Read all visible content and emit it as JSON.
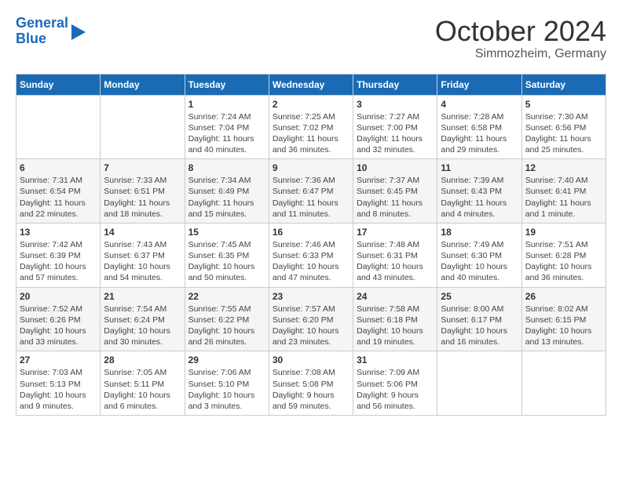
{
  "logo": {
    "line1": "General",
    "line2": "Blue"
  },
  "title": "October 2024",
  "subtitle": "Simmozheim, Germany",
  "days_of_week": [
    "Sunday",
    "Monday",
    "Tuesday",
    "Wednesday",
    "Thursday",
    "Friday",
    "Saturday"
  ],
  "weeks": [
    [
      {
        "day": "",
        "info": ""
      },
      {
        "day": "",
        "info": ""
      },
      {
        "day": "1",
        "info": "Sunrise: 7:24 AM\nSunset: 7:04 PM\nDaylight: 11 hours and 40 minutes."
      },
      {
        "day": "2",
        "info": "Sunrise: 7:25 AM\nSunset: 7:02 PM\nDaylight: 11 hours and 36 minutes."
      },
      {
        "day": "3",
        "info": "Sunrise: 7:27 AM\nSunset: 7:00 PM\nDaylight: 11 hours and 32 minutes."
      },
      {
        "day": "4",
        "info": "Sunrise: 7:28 AM\nSunset: 6:58 PM\nDaylight: 11 hours and 29 minutes."
      },
      {
        "day": "5",
        "info": "Sunrise: 7:30 AM\nSunset: 6:56 PM\nDaylight: 11 hours and 25 minutes."
      }
    ],
    [
      {
        "day": "6",
        "info": "Sunrise: 7:31 AM\nSunset: 6:54 PM\nDaylight: 11 hours and 22 minutes."
      },
      {
        "day": "7",
        "info": "Sunrise: 7:33 AM\nSunset: 6:51 PM\nDaylight: 11 hours and 18 minutes."
      },
      {
        "day": "8",
        "info": "Sunrise: 7:34 AM\nSunset: 6:49 PM\nDaylight: 11 hours and 15 minutes."
      },
      {
        "day": "9",
        "info": "Sunrise: 7:36 AM\nSunset: 6:47 PM\nDaylight: 11 hours and 11 minutes."
      },
      {
        "day": "10",
        "info": "Sunrise: 7:37 AM\nSunset: 6:45 PM\nDaylight: 11 hours and 8 minutes."
      },
      {
        "day": "11",
        "info": "Sunrise: 7:39 AM\nSunset: 6:43 PM\nDaylight: 11 hours and 4 minutes."
      },
      {
        "day": "12",
        "info": "Sunrise: 7:40 AM\nSunset: 6:41 PM\nDaylight: 11 hours and 1 minute."
      }
    ],
    [
      {
        "day": "13",
        "info": "Sunrise: 7:42 AM\nSunset: 6:39 PM\nDaylight: 10 hours and 57 minutes."
      },
      {
        "day": "14",
        "info": "Sunrise: 7:43 AM\nSunset: 6:37 PM\nDaylight: 10 hours and 54 minutes."
      },
      {
        "day": "15",
        "info": "Sunrise: 7:45 AM\nSunset: 6:35 PM\nDaylight: 10 hours and 50 minutes."
      },
      {
        "day": "16",
        "info": "Sunrise: 7:46 AM\nSunset: 6:33 PM\nDaylight: 10 hours and 47 minutes."
      },
      {
        "day": "17",
        "info": "Sunrise: 7:48 AM\nSunset: 6:31 PM\nDaylight: 10 hours and 43 minutes."
      },
      {
        "day": "18",
        "info": "Sunrise: 7:49 AM\nSunset: 6:30 PM\nDaylight: 10 hours and 40 minutes."
      },
      {
        "day": "19",
        "info": "Sunrise: 7:51 AM\nSunset: 6:28 PM\nDaylight: 10 hours and 36 minutes."
      }
    ],
    [
      {
        "day": "20",
        "info": "Sunrise: 7:52 AM\nSunset: 6:26 PM\nDaylight: 10 hours and 33 minutes."
      },
      {
        "day": "21",
        "info": "Sunrise: 7:54 AM\nSunset: 6:24 PM\nDaylight: 10 hours and 30 minutes."
      },
      {
        "day": "22",
        "info": "Sunrise: 7:55 AM\nSunset: 6:22 PM\nDaylight: 10 hours and 26 minutes."
      },
      {
        "day": "23",
        "info": "Sunrise: 7:57 AM\nSunset: 6:20 PM\nDaylight: 10 hours and 23 minutes."
      },
      {
        "day": "24",
        "info": "Sunrise: 7:58 AM\nSunset: 6:18 PM\nDaylight: 10 hours and 19 minutes."
      },
      {
        "day": "25",
        "info": "Sunrise: 8:00 AM\nSunset: 6:17 PM\nDaylight: 10 hours and 16 minutes."
      },
      {
        "day": "26",
        "info": "Sunrise: 8:02 AM\nSunset: 6:15 PM\nDaylight: 10 hours and 13 minutes."
      }
    ],
    [
      {
        "day": "27",
        "info": "Sunrise: 7:03 AM\nSunset: 5:13 PM\nDaylight: 10 hours and 9 minutes."
      },
      {
        "day": "28",
        "info": "Sunrise: 7:05 AM\nSunset: 5:11 PM\nDaylight: 10 hours and 6 minutes."
      },
      {
        "day": "29",
        "info": "Sunrise: 7:06 AM\nSunset: 5:10 PM\nDaylight: 10 hours and 3 minutes."
      },
      {
        "day": "30",
        "info": "Sunrise: 7:08 AM\nSunset: 5:08 PM\nDaylight: 9 hours and 59 minutes."
      },
      {
        "day": "31",
        "info": "Sunrise: 7:09 AM\nSunset: 5:06 PM\nDaylight: 9 hours and 56 minutes."
      },
      {
        "day": "",
        "info": ""
      },
      {
        "day": "",
        "info": ""
      }
    ]
  ]
}
